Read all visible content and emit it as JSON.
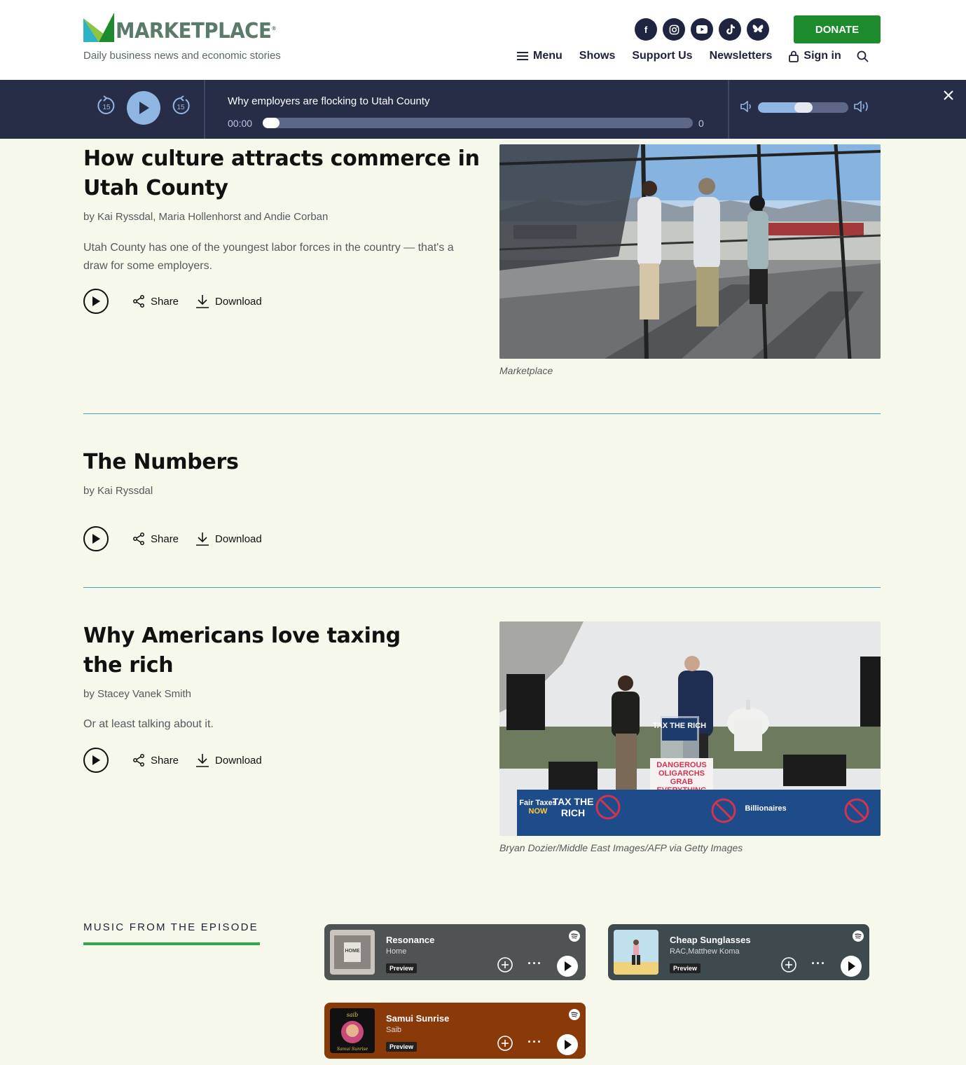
{
  "header": {
    "logo_text": "MARKETPLACE",
    "tagline": "Daily business news and economic stories",
    "socials": [
      "facebook",
      "instagram",
      "youtube",
      "tiktok",
      "bluesky"
    ],
    "donate_label": "DONATE",
    "nav": {
      "menu": "Menu",
      "shows": "Shows",
      "support": "Support Us",
      "newsletters": "Newsletters",
      "signin": "Sign in"
    }
  },
  "player": {
    "title": "Why employers are flocking to Utah County",
    "current_time": "00:00",
    "duration": "0",
    "skip_seconds": "15",
    "progress_fraction": 0,
    "volume_fraction": 0.5
  },
  "actions": {
    "share": "Share",
    "download": "Download"
  },
  "stories": [
    {
      "title_line1": "How culture attracts commerce in",
      "title_line2": "Utah County",
      "byline": "by Kai Ryssdal, Maria Hollenhorst and Andie Corban",
      "description_line1": "Utah County has one of the youngest labor forces in the country — that's a",
      "description_line2": "draw for some employers.",
      "caption": "Marketplace"
    },
    {
      "title_line1": "The Numbers",
      "byline": "by Kai Ryssdal"
    },
    {
      "title_line1": "Why Americans love taxing",
      "title_line2": "the rich",
      "byline": "by Stacey Vanek Smith",
      "description_line1": "Or at least talking about it.",
      "caption": "Bryan Dozier/Middle East Images/AFP via Getty Images",
      "photo_signs": [
        "TAX THE RICH",
        "DANGEROUS",
        "OLIGARCHS",
        "GRAB",
        "EVERYTHING",
        "Fair Taxes",
        "NOW",
        "TAX THE",
        "RICH",
        "Billionaires"
      ]
    }
  ],
  "music": {
    "heading": "MUSIC FROM THE EPISODE",
    "preview_label": "Preview",
    "tracks": [
      {
        "title": "Resonance",
        "artist": "Home",
        "bg": "#505354"
      },
      {
        "title": "Cheap Sunglasses",
        "artist": "RAC,Matthew Koma",
        "bg": "#3f4a4f"
      },
      {
        "title": "Samui Sunrise",
        "artist": "Saib",
        "bg": "#8a3a09"
      }
    ],
    "album_art_text": {
      "home": "HOME",
      "saib": "saib",
      "samui": "Samui Sunrise"
    }
  },
  "colors": {
    "page_bg": "#f5f8ea",
    "navy": "#272d47",
    "donate_green": "#1d8a2e",
    "rule_teal": "#4aa3b5",
    "accent_blue": "#8fb6e2"
  }
}
